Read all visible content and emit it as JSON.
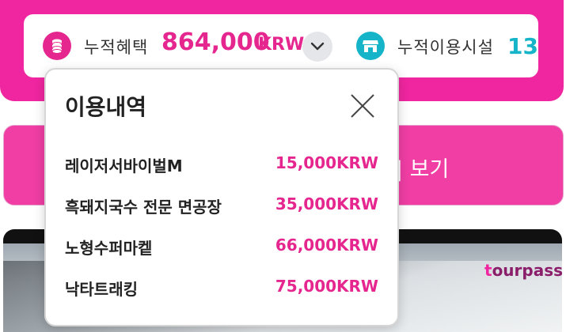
{
  "summary": {
    "benefit_label": "누적혜택",
    "benefit_amount": "864,000",
    "benefit_unit": "KRW",
    "facility_label": "누적이용시설",
    "facility_count": "13"
  },
  "action_button": {
    "label": "| 보기"
  },
  "banner": {
    "brand_logo_text": "tourpass"
  },
  "usage_popup": {
    "title": "이용내역",
    "items": [
      {
        "name": "레이저서바이벌M",
        "price": "15,000KRW"
      },
      {
        "name": "흑돼지국수 전문 면공장",
        "price": "35,000KRW"
      },
      {
        "name": "노형수퍼마켙",
        "price": "66,000KRW"
      },
      {
        "name": "낙타트래킹",
        "price": "75,000KRW"
      }
    ]
  },
  "icons": {
    "benefit": "coin-stack-icon",
    "expand": "chevron-down-icon",
    "facility": "shop-icon",
    "close": "close-icon"
  },
  "colors": {
    "brand_pink": "#e6268f",
    "accent_teal": "#16b4c8"
  }
}
